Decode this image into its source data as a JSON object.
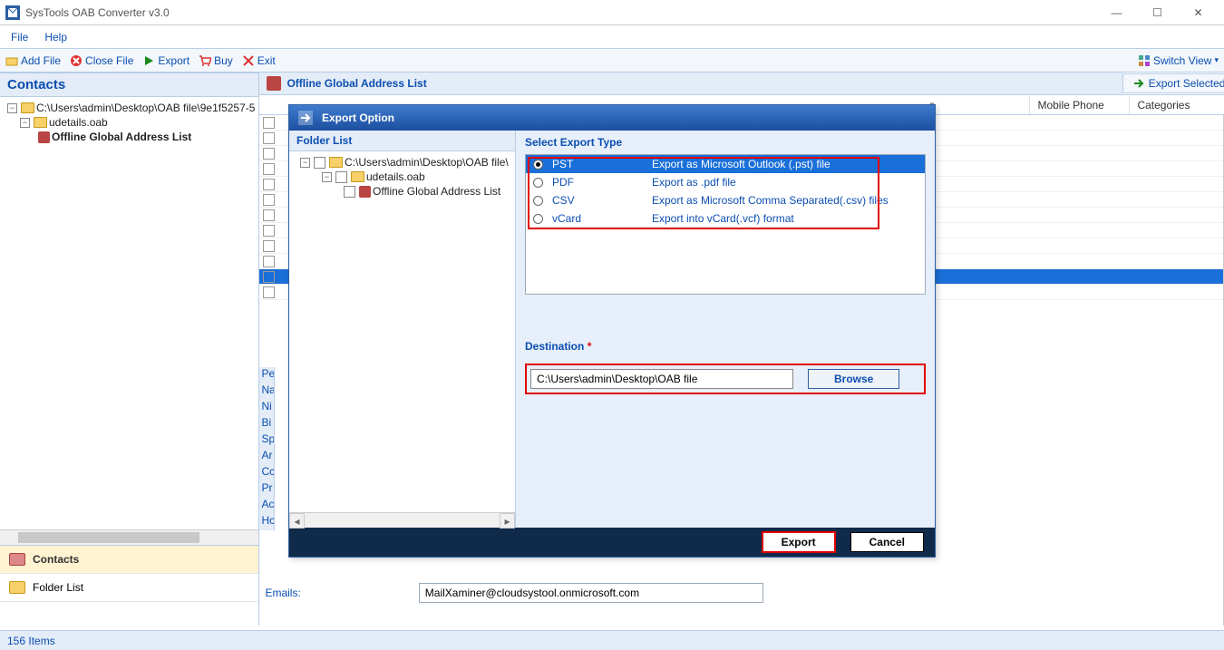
{
  "window": {
    "title": "SysTools OAB Converter v3.0"
  },
  "menu": {
    "file": "File",
    "help": "Help"
  },
  "toolbar": {
    "add_file": "Add File",
    "close_file": "Close File",
    "export": "Export",
    "buy": "Buy",
    "exit": "Exit",
    "switch_view": "Switch View"
  },
  "left": {
    "header": "Contacts",
    "tree": {
      "root": "C:\\Users\\admin\\Desktop\\OAB file\\9e1f5257-5",
      "file": "udetails.oab",
      "list": "Offline Global Address List"
    },
    "nav": {
      "contacts": "Contacts",
      "folder_list": "Folder List"
    }
  },
  "right": {
    "header": "Offline Global Address List",
    "export_selected": "Export Selected",
    "cols": {
      "e": "e",
      "mobile": "Mobile Phone",
      "categories": "Categories"
    },
    "emails_label": "Emails:",
    "emails_value": "MailXaminer@cloudsystool.onmicrosoft.com",
    "partial_labels": [
      "Pe",
      "Na",
      "Ni",
      "Bi",
      "Sp",
      "Ar",
      "Cc",
      "Pr",
      "Ac",
      "Hc"
    ]
  },
  "dialog": {
    "title": "Export Option",
    "folder_list_hdr": "Folder List",
    "tree": {
      "root": "C:\\Users\\admin\\Desktop\\OAB file\\",
      "file": "udetails.oab",
      "list": "Offline Global Address List"
    },
    "select_export_hdr": "Select Export Type",
    "types": [
      {
        "name": "PST",
        "desc": "Export as Microsoft Outlook (.pst) file",
        "selected": true
      },
      {
        "name": "PDF",
        "desc": "Export as .pdf file",
        "selected": false
      },
      {
        "name": "CSV",
        "desc": "Export as Microsoft Comma Separated(.csv) files",
        "selected": false
      },
      {
        "name": "vCard",
        "desc": "Export into vCard(.vcf) format",
        "selected": false
      }
    ],
    "destination_label": "Destination",
    "destination_value": "C:\\Users\\admin\\Desktop\\OAB file",
    "browse": "Browse",
    "export_btn": "Export",
    "cancel_btn": "Cancel"
  },
  "status": {
    "items": "156 Items"
  }
}
